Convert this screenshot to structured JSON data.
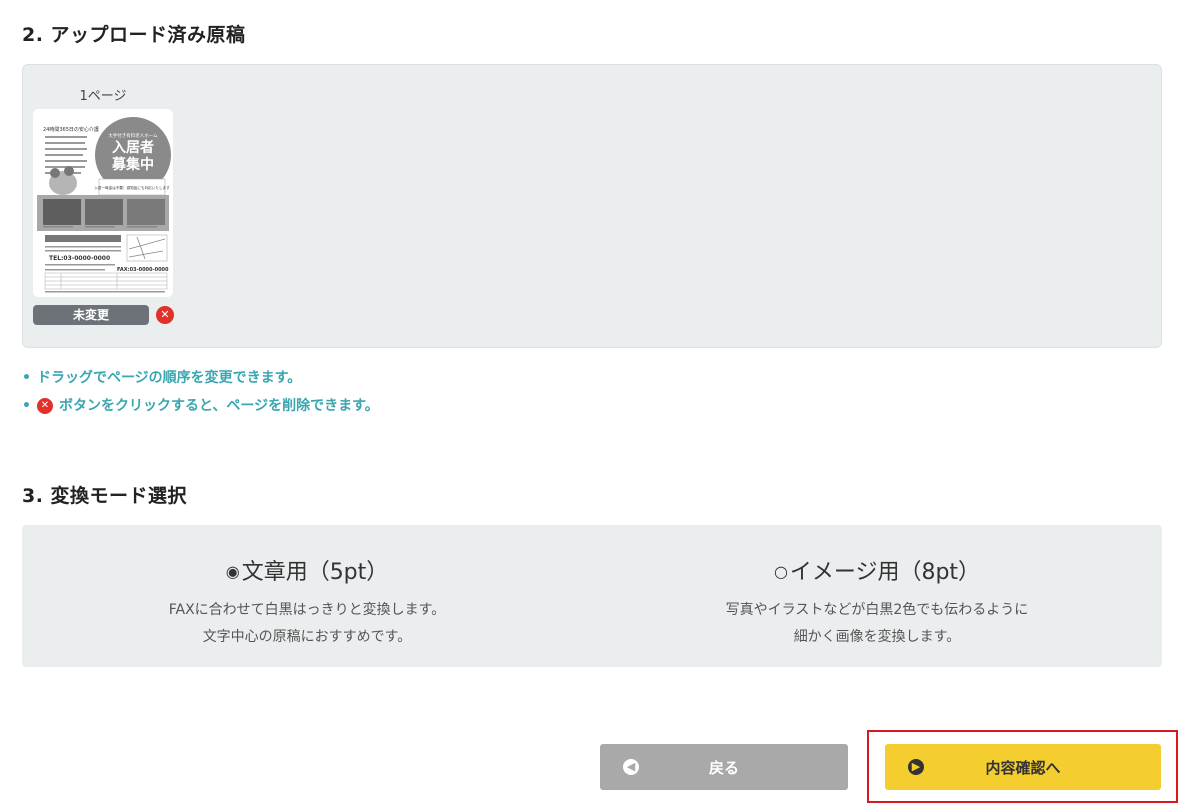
{
  "section2": {
    "title": "2. アップロード済み原稿",
    "pages": [
      {
        "label": "1ページ",
        "status": "未変更",
        "thumbnail": {
          "subtitle": "大手付き有料老人ホーム",
          "headline_line1": "入居者",
          "headline_line2": "募集中",
          "top_text": "24時間365日の安心介護",
          "tagline": "入居一時金は不要！認知症にも対応いたします",
          "tel": "TEL:03-0000-0000",
          "fax": "FAX:03-0000-0000"
        }
      }
    ],
    "notes": [
      "ドラッグでページの順序を変更できます。",
      "ボタンをクリックすると、ページを削除できます。"
    ]
  },
  "section3": {
    "title": "3. 変換モード選択",
    "options": [
      {
        "radio": "◉",
        "label": "文章用（5pt）",
        "selected": true,
        "desc_line1": "FAXに合わせて白黒はっきりと変換します。",
        "desc_line2": "文字中心の原稿におすすめです。"
      },
      {
        "radio": "○",
        "label": "イメージ用（8pt）",
        "selected": false,
        "desc_line1": "写真やイラストなどが白黒2色でも伝わるように",
        "desc_line2": "細かく画像を変換します。"
      }
    ]
  },
  "buttons": {
    "back_label": "戻る",
    "next_label": "内容確認へ"
  },
  "colors": {
    "accent_teal": "#3aa6b0",
    "delete_red": "#e2312a",
    "next_yellow": "#f4cd2e",
    "back_gray": "#a9a9a9",
    "highlight_red": "#d71920"
  },
  "icons": {
    "delete": "close-circle-icon",
    "back": "arrow-left-circle-icon",
    "next": "arrow-right-circle-icon"
  }
}
